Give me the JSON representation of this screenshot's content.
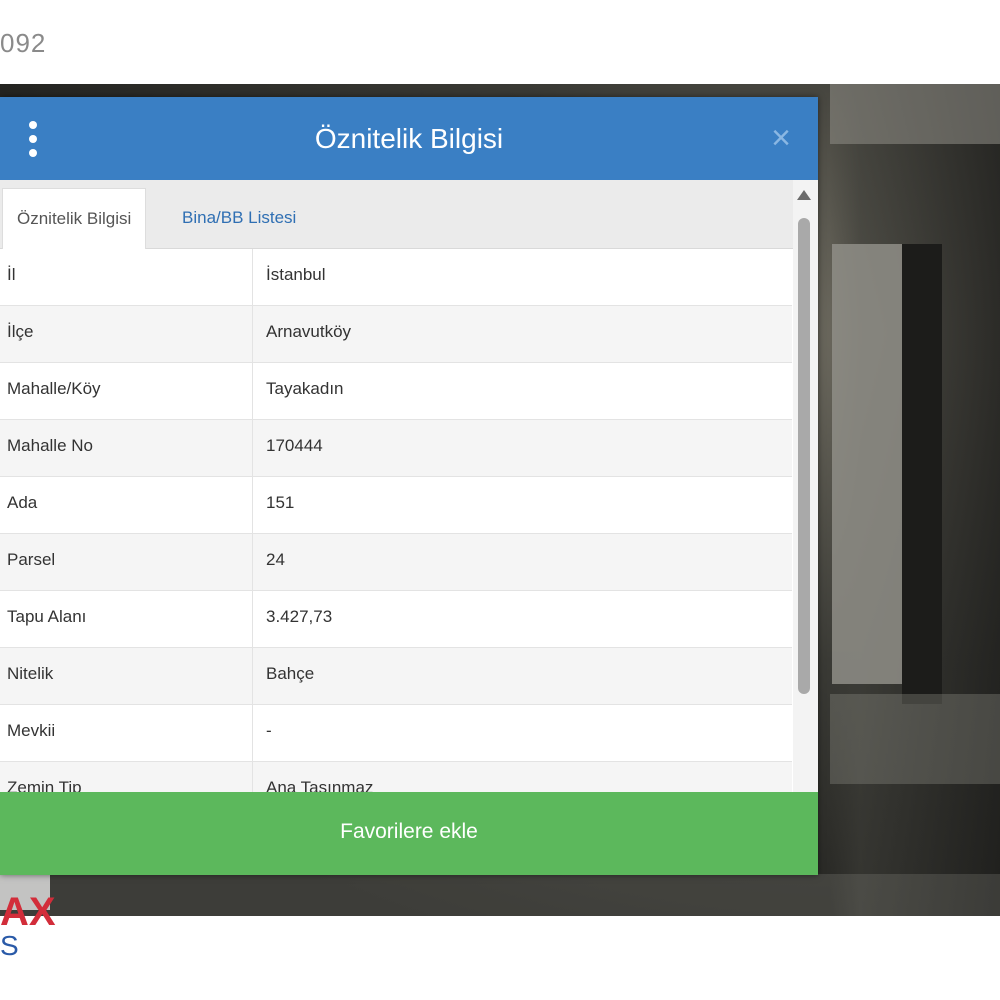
{
  "page": {
    "top_label": "092"
  },
  "watermark": {
    "text": "AX",
    "sub": "S"
  },
  "dialog": {
    "title": "Öznitelik Bilgisi",
    "menu_icon": "vertical-dots-icon",
    "close_icon": "close-icon",
    "close_glyph": "×",
    "header_color": "#3a7fc4",
    "tabs": [
      {
        "label": "Öznitelik Bilgisi",
        "active": true
      },
      {
        "label": "Bina/BB Listesi",
        "active": false
      }
    ],
    "rows": [
      {
        "label": "İl",
        "value": "İstanbul"
      },
      {
        "label": "İlçe",
        "value": "Arnavutköy"
      },
      {
        "label": "Mahalle/Köy",
        "value": "Tayakadın"
      },
      {
        "label": "Mahalle No",
        "value": "170444"
      },
      {
        "label": "Ada",
        "value": "151"
      },
      {
        "label": "Parsel",
        "value": "24"
      },
      {
        "label": "Tapu Alanı",
        "value": "3.427,73"
      },
      {
        "label": "Nitelik",
        "value": "Bahçe"
      },
      {
        "label": "Mevkii",
        "value": "-"
      },
      {
        "label": "Zemin Tip",
        "value": "Ana Taşınmaz"
      }
    ],
    "favorite_button": {
      "label": "Favorilere ekle",
      "color": "#5cb85c"
    }
  }
}
